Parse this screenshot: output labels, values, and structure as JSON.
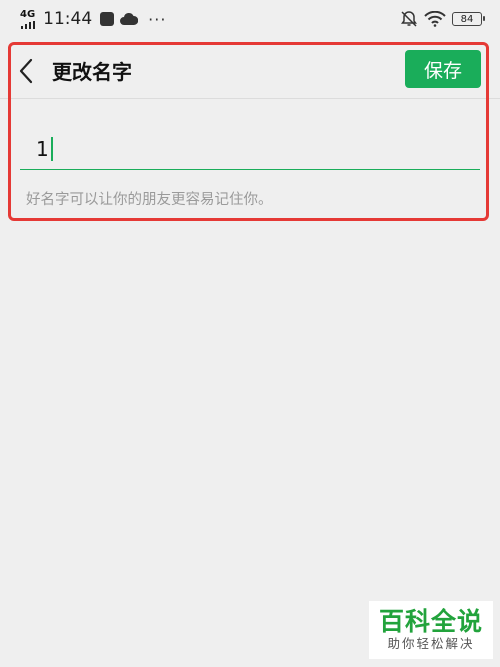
{
  "status_bar": {
    "network": "4G",
    "time": "11:44",
    "more": "···",
    "battery": "84"
  },
  "header": {
    "title": "更改名字",
    "save_label": "保存"
  },
  "name_field": {
    "value": "1"
  },
  "hint": "好名字可以让你的朋友更容易记住你。",
  "watermark": {
    "title": "百科全说",
    "subtitle": "助你轻松解决"
  },
  "colors": {
    "accent": "#1aad5a",
    "highlight": "#e53935",
    "background": "#efefef",
    "hint": "#9a9a9a"
  },
  "icons": {
    "back": "chevron-left-icon",
    "bell_off": "bell-off-icon",
    "wifi": "wifi-icon",
    "battery": "battery-icon",
    "cloud": "cloud-icon",
    "app": "app-notification-icon"
  }
}
